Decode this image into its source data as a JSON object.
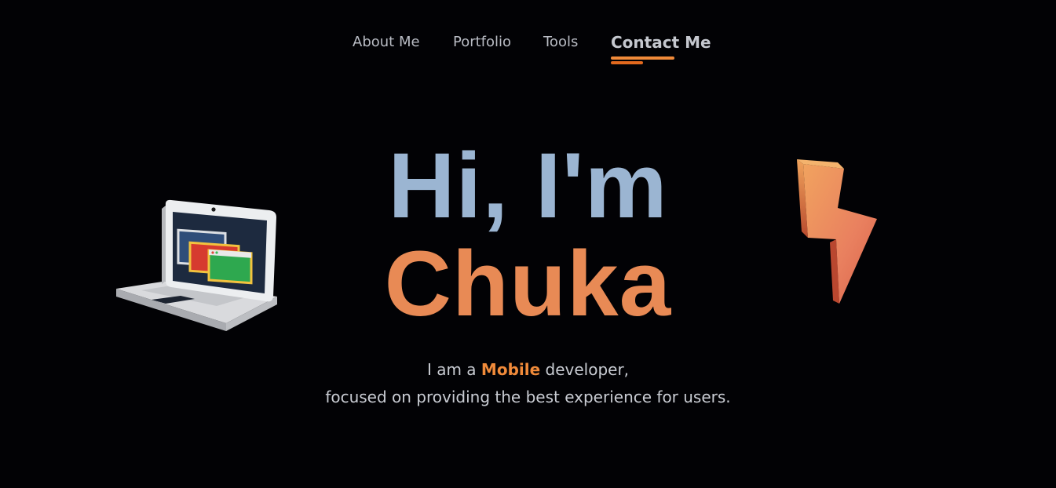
{
  "nav": {
    "items": [
      {
        "label": "About Me"
      },
      {
        "label": "Portfolio"
      },
      {
        "label": "Tools"
      },
      {
        "label": "Contact Me"
      }
    ],
    "active_index": 3,
    "accent_color": "#f08a3a"
  },
  "hero": {
    "greeting": "Hi, I'm",
    "name": "Chuka",
    "greeting_color": "#9bb5d2",
    "name_color": "#e88a55"
  },
  "intro": {
    "line1_prefix": "I am a",
    "line1_highlight": "Mobile",
    "line1_suffix": "developer,",
    "line2": "focused on providing the best experience for users."
  },
  "illustrations": {
    "left": "laptop-icon",
    "right": "lightning-bolt-icon"
  }
}
